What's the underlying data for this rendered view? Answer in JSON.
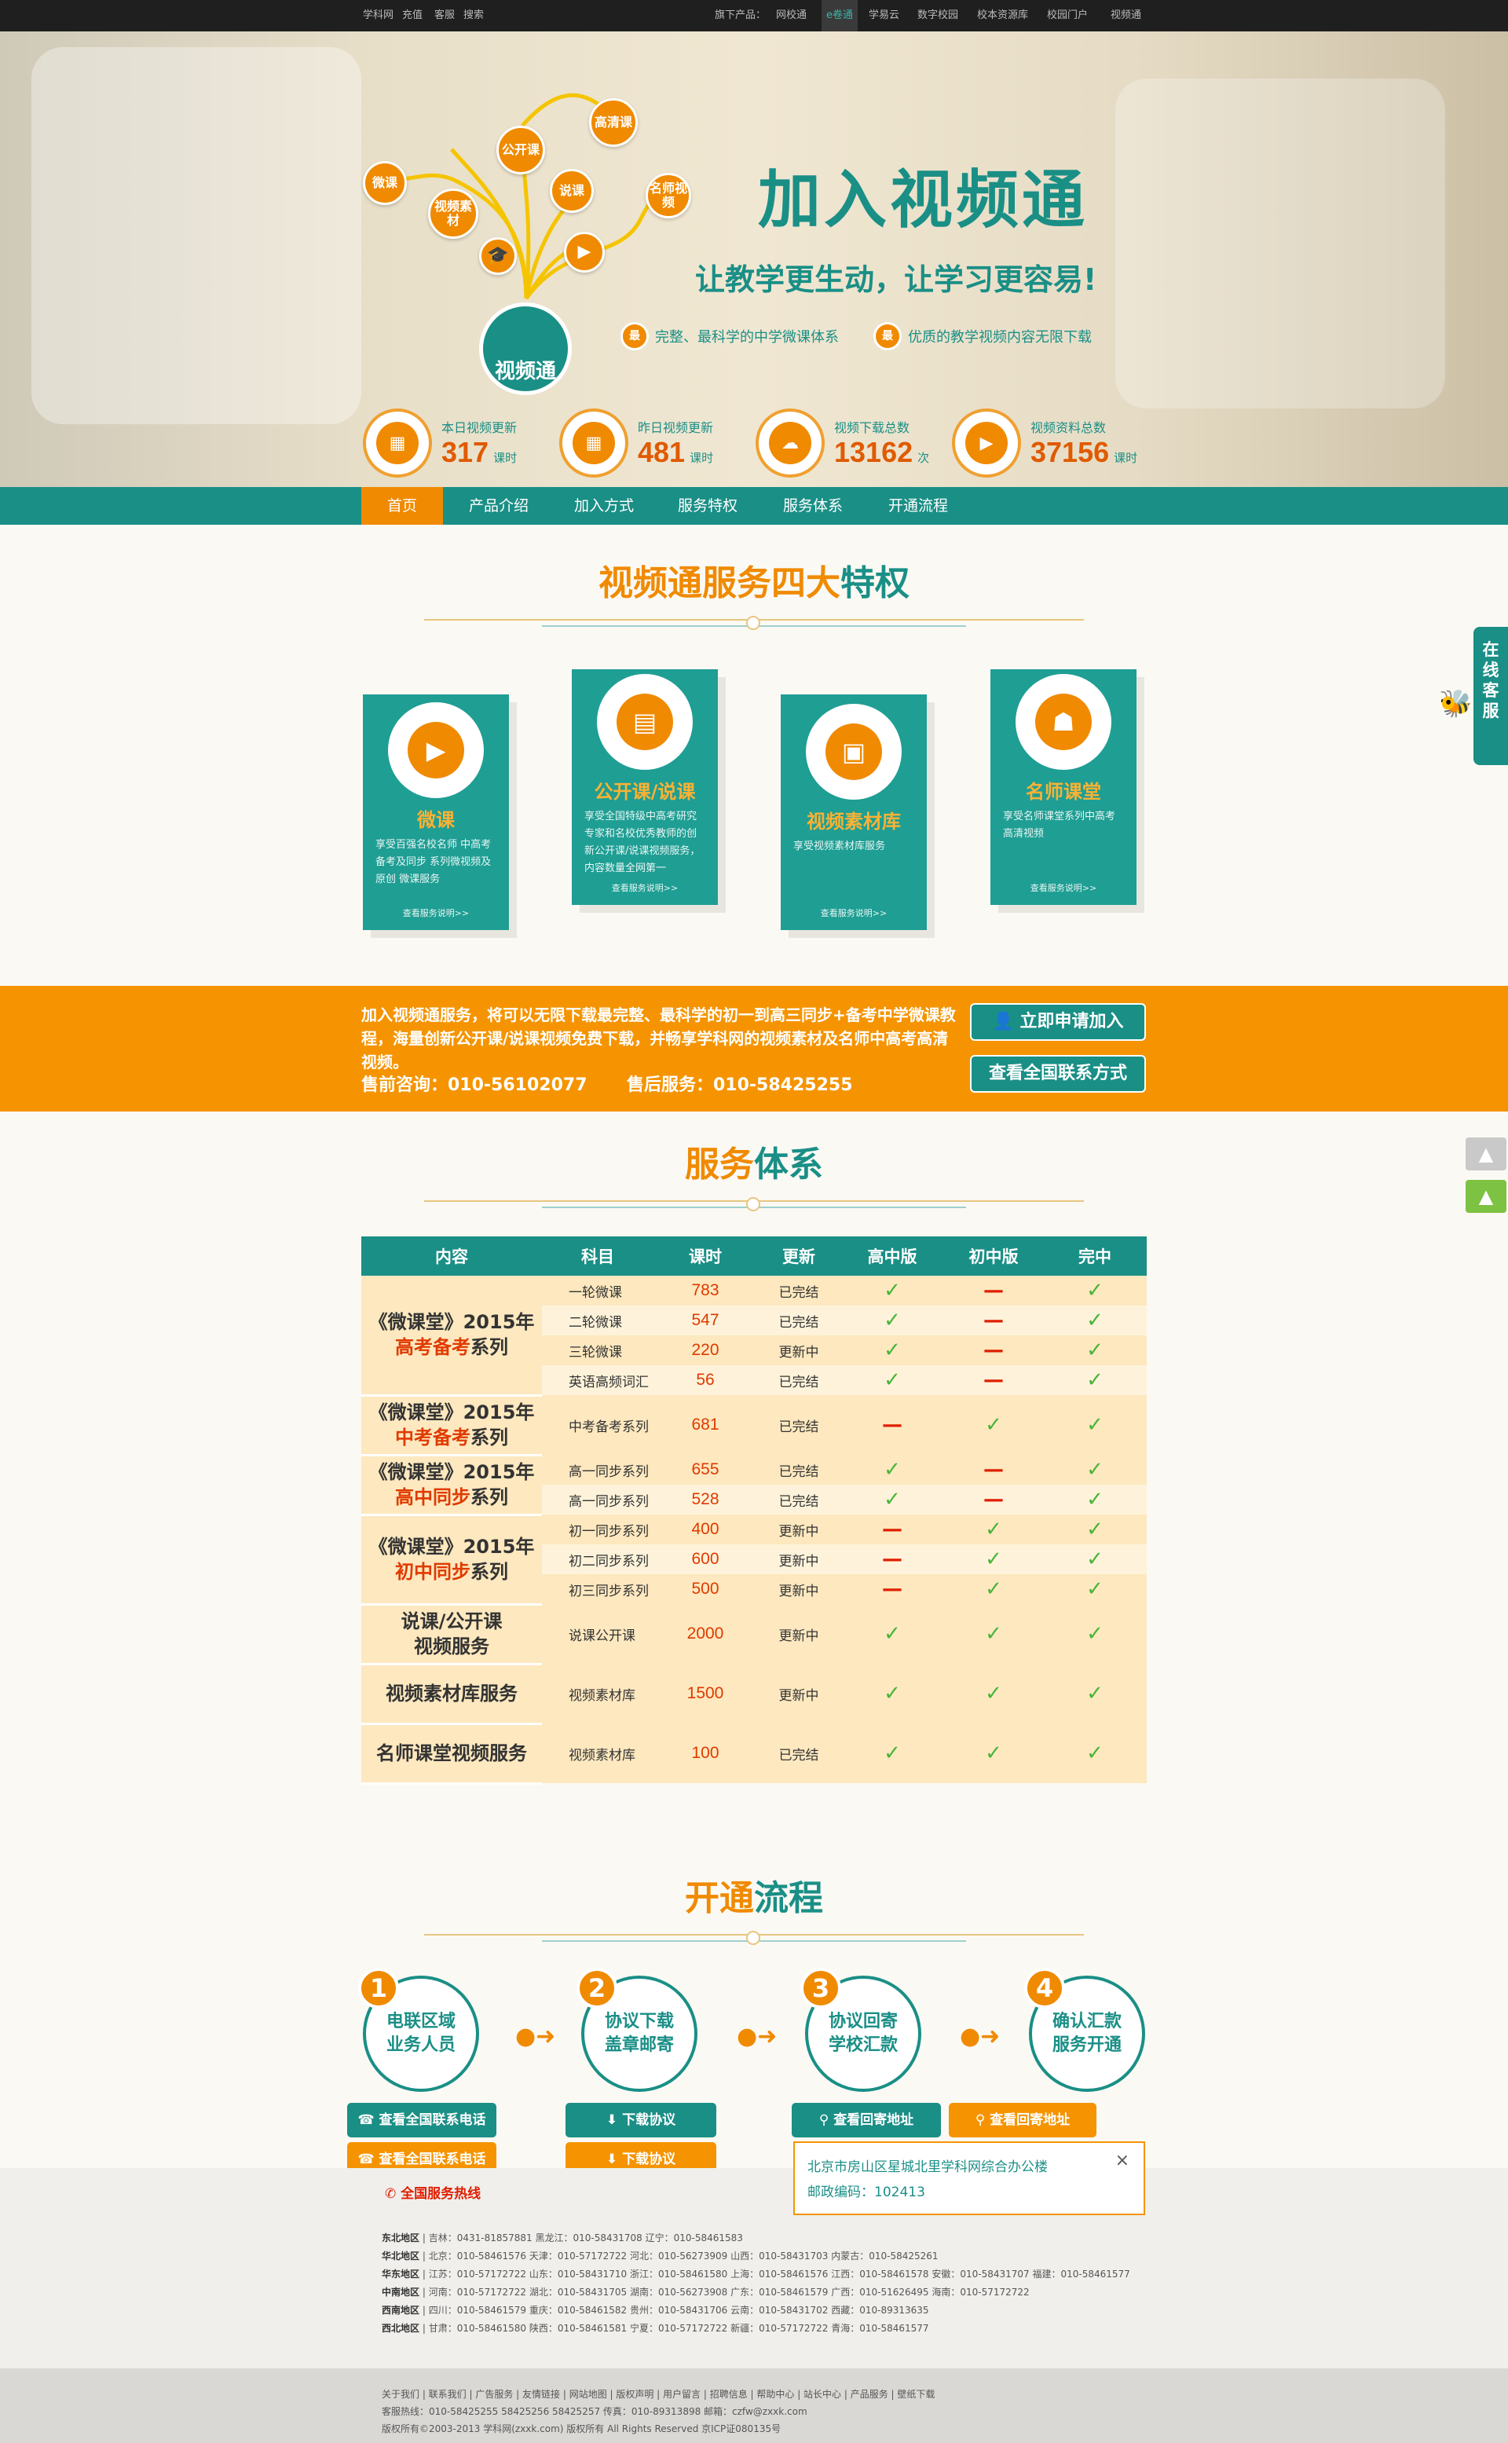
{
  "topbar": {
    "left": [
      "学科网",
      "充值",
      "客服",
      "搜索"
    ],
    "products_label": "旗下产品：",
    "products": [
      "网校通",
      "e卷通",
      "学易云",
      "数字校园",
      "校本资源库",
      "校园门户",
      "视频通"
    ],
    "active_product": "e卷通"
  },
  "hero": {
    "bubbles": [
      "微课",
      "视频素材",
      "公开课",
      "说课",
      "高清课",
      "名师视频"
    ],
    "logo_text": "视频通",
    "title": "加入视频通",
    "subtitle": "让教学更生动，让学习更容易!",
    "features": [
      {
        "badge": "最",
        "text": "完整、最科学的中学微课体系"
      },
      {
        "badge": "最",
        "text": "优质的教学视频内容无限下载"
      }
    ],
    "stats": [
      {
        "label": "本日视频更新",
        "value": "317",
        "unit": "课时",
        "icon": "calendar-icon"
      },
      {
        "label": "昨日视频更新",
        "value": "481",
        "unit": "课时",
        "icon": "calendar-icon"
      },
      {
        "label": "视频下载总数",
        "value": "13162",
        "unit": "次",
        "icon": "cloud-download-icon"
      },
      {
        "label": "视频资料总数",
        "value": "37156",
        "unit": "课时",
        "icon": "play-icon"
      }
    ]
  },
  "nav": {
    "items": [
      "首页",
      "产品介绍",
      "加入方式",
      "服务特权",
      "服务体系",
      "开通流程"
    ],
    "active": "首页"
  },
  "privileges": {
    "title_a": "视频通服务",
    "title_b": "四大",
    "title_c": "特权",
    "cards": [
      {
        "name": "微课",
        "desc": "享受百强名校名师 中高考备考及同步 系列微视频及原创 微课服务",
        "more": "查看服务说明>>",
        "icon": "play-icon"
      },
      {
        "name": "公开课/说课",
        "desc": "享受全国特级中高考研究专家和名校优秀教师的创新公开课/说课视频服务，内容数量全网第一",
        "more": "查看服务说明>>",
        "icon": "lecture-icon"
      },
      {
        "name": "视频素材库",
        "desc": "享受视频素材库服务",
        "more": "查看服务说明>>",
        "icon": "video-window-icon"
      },
      {
        "name": "名师课堂",
        "desc": "享受名师课堂系列中高考高清视频",
        "more": "查看服务说明>>",
        "icon": "teacher-icon"
      }
    ]
  },
  "band": {
    "text": "加入视频通服务，将可以无限下载最完整、最科学的初一到高三同步+备考中学微课教程，海量创新公开课/说课视频免费下载，并畅享学科网的视频素材及名师中高考高清视频。",
    "presale": "售前咨询：010-56102077",
    "aftersale": "售后服务：010-58425255",
    "apply_btn": "立即申请加入",
    "contact_btn": "查看全国联系方式"
  },
  "system": {
    "title_a": "服务",
    "title_b": "体系",
    "headers": [
      "内容",
      "科目",
      "课时",
      "更新",
      "高中版",
      "初中版",
      "完中"
    ],
    "groups": [
      {
        "title_a": "《微课堂》2015年",
        "title_b": "高考备考",
        "title_c": "系列",
        "rows": [
          {
            "subject": "一轮微课",
            "hours": "783",
            "status": "已完结",
            "h": "check",
            "m": "dash",
            "f": "check"
          },
          {
            "subject": "二轮微课",
            "hours": "547",
            "status": "已完结",
            "h": "check",
            "m": "dash",
            "f": "check"
          },
          {
            "subject": "三轮微课",
            "hours": "220",
            "status": "更新中",
            "h": "check",
            "m": "dash",
            "f": "check"
          },
          {
            "subject": "英语高频词汇",
            "hours": "56",
            "status": "已完结",
            "h": "check",
            "m": "dash",
            "f": "check"
          }
        ]
      },
      {
        "title_a": "《微课堂》2015年",
        "title_b": "中考备考",
        "title_c": "系列",
        "rows": [
          {
            "subject": "中考备考系列",
            "hours": "681",
            "status": "已完结",
            "h": "dash",
            "m": "check",
            "f": "check"
          }
        ]
      },
      {
        "title_a": "《微课堂》2015年",
        "title_b": "高中同步",
        "title_c": "系列",
        "rows": [
          {
            "subject": "高一同步系列",
            "hours": "655",
            "status": "已完结",
            "h": "check",
            "m": "dash",
            "f": "check"
          },
          {
            "subject": "高一同步系列",
            "hours": "528",
            "status": "已完结",
            "h": "check",
            "m": "dash",
            "f": "check"
          }
        ]
      },
      {
        "title_a": "《微课堂》2015年",
        "title_b": "初中同步",
        "title_c": "系列",
        "rows": [
          {
            "subject": "初一同步系列",
            "hours": "400",
            "status": "更新中",
            "h": "dash",
            "m": "check",
            "f": "check"
          },
          {
            "subject": "初二同步系列",
            "hours": "600",
            "status": "更新中",
            "h": "dash",
            "m": "check",
            "f": "check"
          },
          {
            "subject": "初三同步系列",
            "hours": "500",
            "status": "更新中",
            "h": "dash",
            "m": "check",
            "f": "check"
          }
        ]
      },
      {
        "title_a": "说课/公开课",
        "title_b": "",
        "title_c": "视频服务",
        "rows": [
          {
            "subject": "说课公开课",
            "hours": "2000",
            "status": "更新中",
            "h": "check",
            "m": "check",
            "f": "check"
          }
        ]
      },
      {
        "title_a": "视频素材库服务",
        "title_b": "",
        "title_c": "",
        "rows": [
          {
            "subject": "视频素材库",
            "hours": "1500",
            "status": "更新中",
            "h": "check",
            "m": "check",
            "f": "check"
          }
        ]
      },
      {
        "title_a": "名师课堂视频服务",
        "title_b": "",
        "title_c": "",
        "rows": [
          {
            "subject": "视频素材库",
            "hours": "100",
            "status": "已完结",
            "h": "check",
            "m": "check",
            "f": "check"
          }
        ]
      }
    ],
    "check_glyph": "✓",
    "dash_glyph": "—"
  },
  "process": {
    "title_a": "开通",
    "title_b": "流程",
    "steps": [
      {
        "num": "1",
        "line1": "电联区域",
        "line2": "业务人员"
      },
      {
        "num": "2",
        "line1": "协议下载",
        "line2": "盖章邮寄"
      },
      {
        "num": "3",
        "line1": "协议回寄",
        "line2": "学校汇款"
      },
      {
        "num": "4",
        "line1": "确认汇款",
        "line2": "服务开通"
      }
    ],
    "buttons": {
      "contact_teal": "查看全国联系电话",
      "contact_orange": "查看全国联系电话",
      "download_teal": "下载协议",
      "download_orange": "下载协议",
      "address_teal": "查看回寄地址",
      "address_orange": "查看回寄地址"
    },
    "hotline": "全国服务热线",
    "popup": {
      "address": "北京市房山区星城北里学科网综合办公楼",
      "postcode": "邮政编码：102413",
      "close": "×"
    }
  },
  "contacts": [
    {
      "region": "东北地区",
      "text": "| 吉林：0431-81857881 黑龙江：010-58431708 辽宁：010-58461583"
    },
    {
      "region": "华北地区",
      "text": "| 北京：010-58461576 天津：010-57172722 河北：010-56273909 山西：010-58431703 内蒙古：010-58425261"
    },
    {
      "region": "华东地区",
      "text": "| 江苏：010-57172722 山东：010-58431710 浙江：010-58461580 上海：010-58461576 江西：010-58461578 安徽：010-58431707 福建：010-58461577"
    },
    {
      "region": "中南地区",
      "text": "| 河南：010-57172722 湖北：010-58431705 湖南：010-56273908 广东：010-58461579 广西：010-51626495 海南：010-57172722"
    },
    {
      "region": "西南地区",
      "text": "| 四川：010-58461579 重庆：010-58461582 贵州：010-58431706 云南：010-58431702 西藏：010-89313635"
    },
    {
      "region": "西北地区",
      "text": "| 甘肃：010-58461580 陕西：010-58461581 宁夏：010-57172722 新疆：010-57172722 青海：010-58461577"
    }
  ],
  "footer": {
    "links": "关于我们 | 联系我们 | 广告服务 | 友情链接 | 网站地图 | 版权声明 | 用户留言 | 招聘信息 | 帮助中心 | 站长中心 | 产品服务 | 壁纸下载",
    "hotline": "客服热线：010-58425255 58425256 58425257 传真：010-89313898 邮箱：czfw@zxxk.com",
    "copyright": "版权所有©2003-2013 学科网(zxxk.com) 版权所有 All Rights Reserved 京ICP证080135号"
  },
  "side": {
    "online": "在线客服",
    "up1": "▲",
    "up2": "▲"
  },
  "colors": {
    "teal": "#1a8f86",
    "orange": "#f08a00",
    "band": "#f59400",
    "check": "#49b43a",
    "dash": "#e01e00"
  }
}
